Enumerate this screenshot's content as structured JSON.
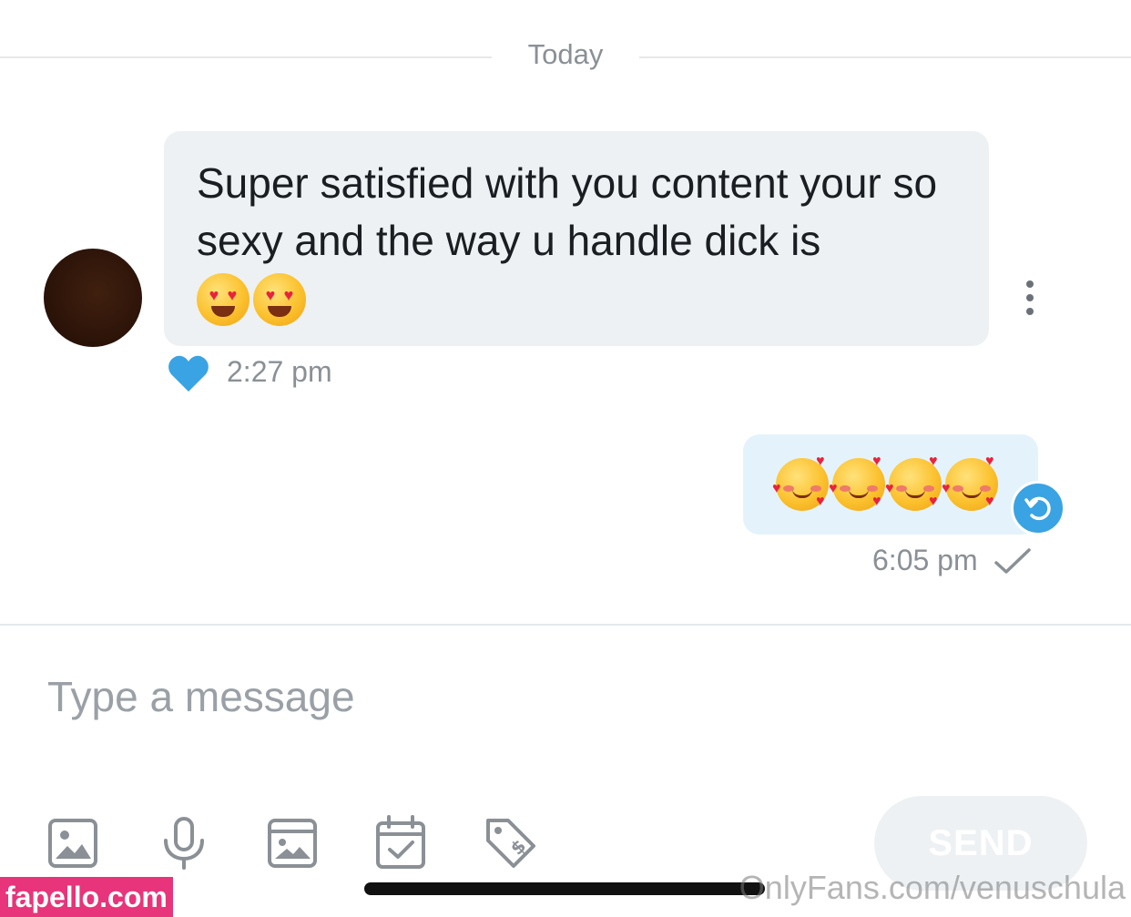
{
  "date_divider": {
    "label": "Today"
  },
  "incoming_message": {
    "text": "Super satisfied with you content your so sexy and the way u handle dick is",
    "emojis": [
      "heart-eyes-emoji",
      "heart-eyes-emoji"
    ],
    "time": "2:27 pm",
    "liked": true
  },
  "outgoing_message": {
    "emojis": [
      "smiling-face-with-hearts-emoji",
      "smiling-face-with-hearts-emoji",
      "smiling-face-with-hearts-emoji",
      "smiling-face-with-hearts-emoji"
    ],
    "time": "6:05 pm",
    "status": "sent"
  },
  "composer": {
    "placeholder": "Type a message",
    "value": "",
    "tools": [
      "image-icon",
      "microphone-icon",
      "gallery-icon",
      "calendar-check-icon",
      "price-tag-icon"
    ],
    "send_label": "SEND"
  },
  "watermarks": {
    "left": "fapello.com",
    "right": "OnlyFans.com/venuschula"
  },
  "colors": {
    "accent": "#3aa3e3",
    "incoming_bubble": "#eef1f3",
    "outgoing_bubble": "#e4f3fb",
    "meta_text": "#8a9096"
  }
}
